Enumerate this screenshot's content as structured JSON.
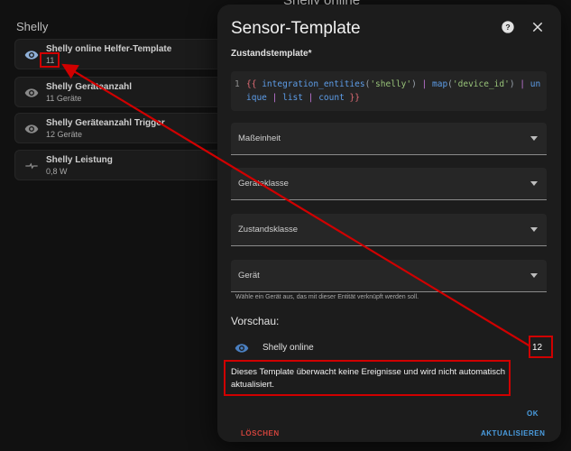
{
  "background": {
    "top_text": "Shelly online",
    "section_title": "Shelly",
    "entities": [
      {
        "name": "Shelly online Helfer-Template",
        "state": "11",
        "icon": "eye-icon"
      },
      {
        "name": "Shelly Geräteanzahl",
        "state": "11 Geräte",
        "icon": "eye-icon"
      },
      {
        "name": "Shelly Geräteanzahl Trigger",
        "state": "12 Geräte",
        "icon": "eye-icon"
      },
      {
        "name": "Shelly Leistung",
        "state": "0,8 W",
        "icon": "dash-line-icon"
      }
    ]
  },
  "dialog": {
    "title": "Sensor-Template",
    "help_icon": "help-circle-icon",
    "close_icon": "close-icon",
    "template_label": "Zustandstemplate*",
    "code": {
      "line_number": "1",
      "open": "{{",
      "fn1": "integration_entities",
      "arg1": "'shelly'",
      "pipe1": "|",
      "fn2": "map",
      "arg2": "'device_id'",
      "pipe2": "|",
      "fn3": "unique",
      "pipe3": "|",
      "fn4": "list",
      "pipe4": "|",
      "fn5": "count",
      "close": "}}"
    },
    "selects": [
      {
        "label": "Maßeinheit"
      },
      {
        "label": "Geräteklasse"
      },
      {
        "label": "Zustandsklasse"
      },
      {
        "label": "Gerät"
      }
    ],
    "device_helper": "Wähle ein Gerät aus, das mit dieser Entität verknüpft werden soll.",
    "preview_title": "Vorschau:",
    "preview_entity": {
      "name": "Shelly online",
      "value": "12",
      "icon": "eye-icon"
    },
    "warning": "Dieses Template überwacht keine Ereignisse und wird nicht automatisch aktualisiert.",
    "ok_label": "OK",
    "delete_label": "LÖSCHEN",
    "update_label": "AKTUALISIEREN"
  },
  "colors": {
    "accent_blue": "#4a9de0",
    "danger_red": "#d0433c",
    "annotation_red": "#d00000"
  }
}
